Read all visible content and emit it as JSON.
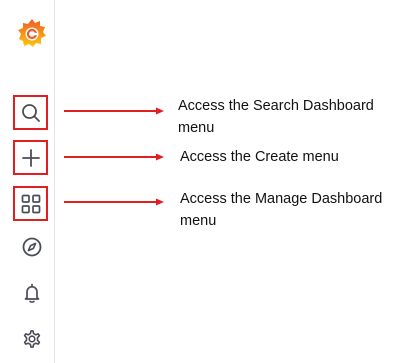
{
  "sidebar": {
    "items": [
      {
        "icon": "grafana-logo-icon"
      },
      {
        "icon": "search-icon",
        "highlighted": true
      },
      {
        "icon": "plus-icon",
        "highlighted": true
      },
      {
        "icon": "dashboards-grid-icon",
        "highlighted": true
      },
      {
        "icon": "compass-icon"
      },
      {
        "icon": "bell-icon"
      },
      {
        "icon": "gear-icon"
      }
    ]
  },
  "callouts": [
    {
      "target": "search-icon",
      "text": "Access the Search Dashboard menu"
    },
    {
      "target": "plus-icon",
      "text": "Access the Create menu"
    },
    {
      "target": "dashboards-grid-icon",
      "text": "Access the Manage Dashboard menu"
    }
  ],
  "colors": {
    "highlight": "#e02020",
    "arrow": "#e02020",
    "icon": "#4a4d57",
    "logo_primary": "#f05a28",
    "logo_secondary": "#fbca0a"
  }
}
